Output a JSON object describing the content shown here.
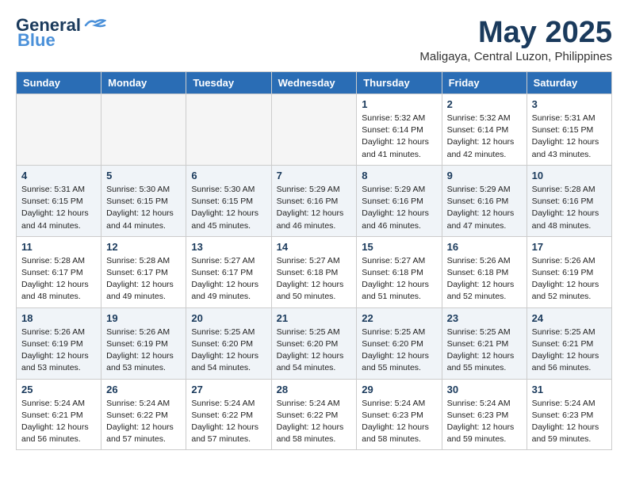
{
  "logo": {
    "line1": "General",
    "line2": "Blue"
  },
  "title": "May 2025",
  "subtitle": "Maligaya, Central Luzon, Philippines",
  "days_of_week": [
    "Sunday",
    "Monday",
    "Tuesday",
    "Wednesday",
    "Thursday",
    "Friday",
    "Saturday"
  ],
  "weeks": [
    [
      {
        "day": "",
        "info": ""
      },
      {
        "day": "",
        "info": ""
      },
      {
        "day": "",
        "info": ""
      },
      {
        "day": "",
        "info": ""
      },
      {
        "day": "1",
        "info": "Sunrise: 5:32 AM\nSunset: 6:14 PM\nDaylight: 12 hours\nand 41 minutes."
      },
      {
        "day": "2",
        "info": "Sunrise: 5:32 AM\nSunset: 6:14 PM\nDaylight: 12 hours\nand 42 minutes."
      },
      {
        "day": "3",
        "info": "Sunrise: 5:31 AM\nSunset: 6:15 PM\nDaylight: 12 hours\nand 43 minutes."
      }
    ],
    [
      {
        "day": "4",
        "info": "Sunrise: 5:31 AM\nSunset: 6:15 PM\nDaylight: 12 hours\nand 44 minutes."
      },
      {
        "day": "5",
        "info": "Sunrise: 5:30 AM\nSunset: 6:15 PM\nDaylight: 12 hours\nand 44 minutes."
      },
      {
        "day": "6",
        "info": "Sunrise: 5:30 AM\nSunset: 6:15 PM\nDaylight: 12 hours\nand 45 minutes."
      },
      {
        "day": "7",
        "info": "Sunrise: 5:29 AM\nSunset: 6:16 PM\nDaylight: 12 hours\nand 46 minutes."
      },
      {
        "day": "8",
        "info": "Sunrise: 5:29 AM\nSunset: 6:16 PM\nDaylight: 12 hours\nand 46 minutes."
      },
      {
        "day": "9",
        "info": "Sunrise: 5:29 AM\nSunset: 6:16 PM\nDaylight: 12 hours\nand 47 minutes."
      },
      {
        "day": "10",
        "info": "Sunrise: 5:28 AM\nSunset: 6:16 PM\nDaylight: 12 hours\nand 48 minutes."
      }
    ],
    [
      {
        "day": "11",
        "info": "Sunrise: 5:28 AM\nSunset: 6:17 PM\nDaylight: 12 hours\nand 48 minutes."
      },
      {
        "day": "12",
        "info": "Sunrise: 5:28 AM\nSunset: 6:17 PM\nDaylight: 12 hours\nand 49 minutes."
      },
      {
        "day": "13",
        "info": "Sunrise: 5:27 AM\nSunset: 6:17 PM\nDaylight: 12 hours\nand 49 minutes."
      },
      {
        "day": "14",
        "info": "Sunrise: 5:27 AM\nSunset: 6:18 PM\nDaylight: 12 hours\nand 50 minutes."
      },
      {
        "day": "15",
        "info": "Sunrise: 5:27 AM\nSunset: 6:18 PM\nDaylight: 12 hours\nand 51 minutes."
      },
      {
        "day": "16",
        "info": "Sunrise: 5:26 AM\nSunset: 6:18 PM\nDaylight: 12 hours\nand 52 minutes."
      },
      {
        "day": "17",
        "info": "Sunrise: 5:26 AM\nSunset: 6:19 PM\nDaylight: 12 hours\nand 52 minutes."
      }
    ],
    [
      {
        "day": "18",
        "info": "Sunrise: 5:26 AM\nSunset: 6:19 PM\nDaylight: 12 hours\nand 53 minutes."
      },
      {
        "day": "19",
        "info": "Sunrise: 5:26 AM\nSunset: 6:19 PM\nDaylight: 12 hours\nand 53 minutes."
      },
      {
        "day": "20",
        "info": "Sunrise: 5:25 AM\nSunset: 6:20 PM\nDaylight: 12 hours\nand 54 minutes."
      },
      {
        "day": "21",
        "info": "Sunrise: 5:25 AM\nSunset: 6:20 PM\nDaylight: 12 hours\nand 54 minutes."
      },
      {
        "day": "22",
        "info": "Sunrise: 5:25 AM\nSunset: 6:20 PM\nDaylight: 12 hours\nand 55 minutes."
      },
      {
        "day": "23",
        "info": "Sunrise: 5:25 AM\nSunset: 6:21 PM\nDaylight: 12 hours\nand 55 minutes."
      },
      {
        "day": "24",
        "info": "Sunrise: 5:25 AM\nSunset: 6:21 PM\nDaylight: 12 hours\nand 56 minutes."
      }
    ],
    [
      {
        "day": "25",
        "info": "Sunrise: 5:24 AM\nSunset: 6:21 PM\nDaylight: 12 hours\nand 56 minutes."
      },
      {
        "day": "26",
        "info": "Sunrise: 5:24 AM\nSunset: 6:22 PM\nDaylight: 12 hours\nand 57 minutes."
      },
      {
        "day": "27",
        "info": "Sunrise: 5:24 AM\nSunset: 6:22 PM\nDaylight: 12 hours\nand 57 minutes."
      },
      {
        "day": "28",
        "info": "Sunrise: 5:24 AM\nSunset: 6:22 PM\nDaylight: 12 hours\nand 58 minutes."
      },
      {
        "day": "29",
        "info": "Sunrise: 5:24 AM\nSunset: 6:23 PM\nDaylight: 12 hours\nand 58 minutes."
      },
      {
        "day": "30",
        "info": "Sunrise: 5:24 AM\nSunset: 6:23 PM\nDaylight: 12 hours\nand 59 minutes."
      },
      {
        "day": "31",
        "info": "Sunrise: 5:24 AM\nSunset: 6:23 PM\nDaylight: 12 hours\nand 59 minutes."
      }
    ]
  ]
}
